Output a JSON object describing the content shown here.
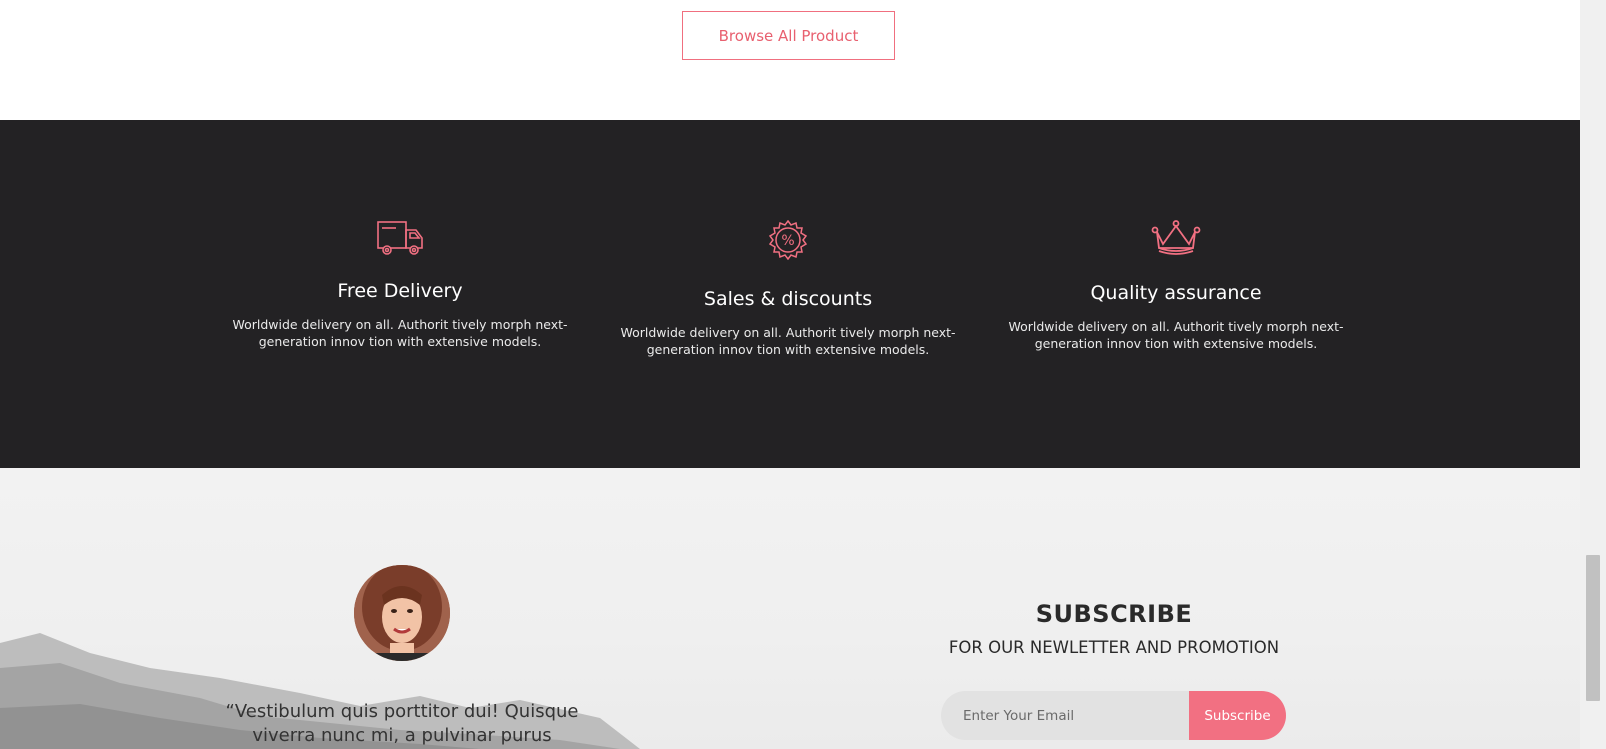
{
  "top": {
    "browse_label": "Browse All Product"
  },
  "features": [
    {
      "icon": "truck-icon",
      "title": "Free Delivery",
      "text": "Worldwide delivery on all. Authorit tively morph next-generation innov tion with extensive models."
    },
    {
      "icon": "discount-badge-icon",
      "title": "Sales & discounts",
      "text": "Worldwide delivery on all. Authorit tively morph next-generation innov tion with extensive models."
    },
    {
      "icon": "crown-icon",
      "title": "Quality assurance",
      "text": "Worldwide delivery on all. Authorit tively morph next-generation innov tion with extensive models."
    }
  ],
  "testimonial": {
    "quote": "“Vestibulum quis porttitor dui! Quisque viverra nunc mi, a pulvinar purus"
  },
  "subscribe": {
    "title": "SUBSCRIBE",
    "subtitle": "FOR OUR NEWLETTER AND PROMOTION",
    "placeholder": "Enter Your Email",
    "button_label": "Subscribe"
  },
  "colors": {
    "accent": "#f27082",
    "dark_band": "#232224",
    "bottom_bg": "#efefef"
  }
}
